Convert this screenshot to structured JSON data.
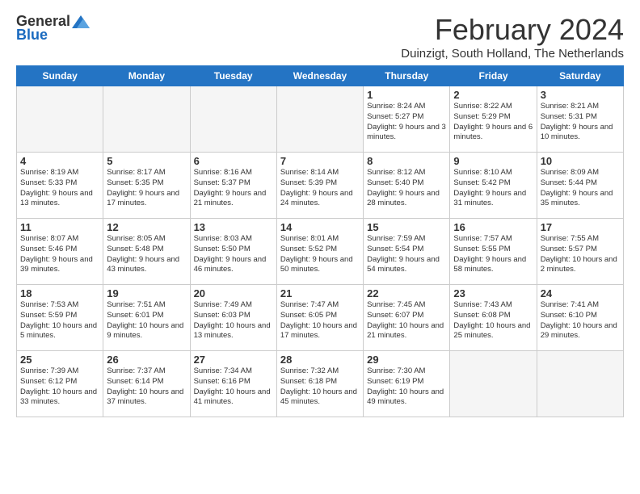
{
  "logo": {
    "general": "General",
    "blue": "Blue"
  },
  "title": "February 2024",
  "subtitle": "Duinzigt, South Holland, The Netherlands",
  "weekdays": [
    "Sunday",
    "Monday",
    "Tuesday",
    "Wednesday",
    "Thursday",
    "Friday",
    "Saturday"
  ],
  "weeks": [
    [
      {
        "day": "",
        "empty": true
      },
      {
        "day": "",
        "empty": true
      },
      {
        "day": "",
        "empty": true
      },
      {
        "day": "",
        "empty": true
      },
      {
        "day": "1",
        "info": "Sunrise: 8:24 AM\nSunset: 5:27 PM\nDaylight: 9 hours\nand 3 minutes."
      },
      {
        "day": "2",
        "info": "Sunrise: 8:22 AM\nSunset: 5:29 PM\nDaylight: 9 hours\nand 6 minutes."
      },
      {
        "day": "3",
        "info": "Sunrise: 8:21 AM\nSunset: 5:31 PM\nDaylight: 9 hours\nand 10 minutes."
      }
    ],
    [
      {
        "day": "4",
        "info": "Sunrise: 8:19 AM\nSunset: 5:33 PM\nDaylight: 9 hours\nand 13 minutes."
      },
      {
        "day": "5",
        "info": "Sunrise: 8:17 AM\nSunset: 5:35 PM\nDaylight: 9 hours\nand 17 minutes."
      },
      {
        "day": "6",
        "info": "Sunrise: 8:16 AM\nSunset: 5:37 PM\nDaylight: 9 hours\nand 21 minutes."
      },
      {
        "day": "7",
        "info": "Sunrise: 8:14 AM\nSunset: 5:39 PM\nDaylight: 9 hours\nand 24 minutes."
      },
      {
        "day": "8",
        "info": "Sunrise: 8:12 AM\nSunset: 5:40 PM\nDaylight: 9 hours\nand 28 minutes."
      },
      {
        "day": "9",
        "info": "Sunrise: 8:10 AM\nSunset: 5:42 PM\nDaylight: 9 hours\nand 31 minutes."
      },
      {
        "day": "10",
        "info": "Sunrise: 8:09 AM\nSunset: 5:44 PM\nDaylight: 9 hours\nand 35 minutes."
      }
    ],
    [
      {
        "day": "11",
        "info": "Sunrise: 8:07 AM\nSunset: 5:46 PM\nDaylight: 9 hours\nand 39 minutes."
      },
      {
        "day": "12",
        "info": "Sunrise: 8:05 AM\nSunset: 5:48 PM\nDaylight: 9 hours\nand 43 minutes."
      },
      {
        "day": "13",
        "info": "Sunrise: 8:03 AM\nSunset: 5:50 PM\nDaylight: 9 hours\nand 46 minutes."
      },
      {
        "day": "14",
        "info": "Sunrise: 8:01 AM\nSunset: 5:52 PM\nDaylight: 9 hours\nand 50 minutes."
      },
      {
        "day": "15",
        "info": "Sunrise: 7:59 AM\nSunset: 5:54 PM\nDaylight: 9 hours\nand 54 minutes."
      },
      {
        "day": "16",
        "info": "Sunrise: 7:57 AM\nSunset: 5:55 PM\nDaylight: 9 hours\nand 58 minutes."
      },
      {
        "day": "17",
        "info": "Sunrise: 7:55 AM\nSunset: 5:57 PM\nDaylight: 10 hours\nand 2 minutes."
      }
    ],
    [
      {
        "day": "18",
        "info": "Sunrise: 7:53 AM\nSunset: 5:59 PM\nDaylight: 10 hours\nand 5 minutes."
      },
      {
        "day": "19",
        "info": "Sunrise: 7:51 AM\nSunset: 6:01 PM\nDaylight: 10 hours\nand 9 minutes."
      },
      {
        "day": "20",
        "info": "Sunrise: 7:49 AM\nSunset: 6:03 PM\nDaylight: 10 hours\nand 13 minutes."
      },
      {
        "day": "21",
        "info": "Sunrise: 7:47 AM\nSunset: 6:05 PM\nDaylight: 10 hours\nand 17 minutes."
      },
      {
        "day": "22",
        "info": "Sunrise: 7:45 AM\nSunset: 6:07 PM\nDaylight: 10 hours\nand 21 minutes."
      },
      {
        "day": "23",
        "info": "Sunrise: 7:43 AM\nSunset: 6:08 PM\nDaylight: 10 hours\nand 25 minutes."
      },
      {
        "day": "24",
        "info": "Sunrise: 7:41 AM\nSunset: 6:10 PM\nDaylight: 10 hours\nand 29 minutes."
      }
    ],
    [
      {
        "day": "25",
        "info": "Sunrise: 7:39 AM\nSunset: 6:12 PM\nDaylight: 10 hours\nand 33 minutes."
      },
      {
        "day": "26",
        "info": "Sunrise: 7:37 AM\nSunset: 6:14 PM\nDaylight: 10 hours\nand 37 minutes."
      },
      {
        "day": "27",
        "info": "Sunrise: 7:34 AM\nSunset: 6:16 PM\nDaylight: 10 hours\nand 41 minutes."
      },
      {
        "day": "28",
        "info": "Sunrise: 7:32 AM\nSunset: 6:18 PM\nDaylight: 10 hours\nand 45 minutes."
      },
      {
        "day": "29",
        "info": "Sunrise: 7:30 AM\nSunset: 6:19 PM\nDaylight: 10 hours\nand 49 minutes."
      },
      {
        "day": "",
        "empty": true
      },
      {
        "day": "",
        "empty": true
      }
    ]
  ]
}
